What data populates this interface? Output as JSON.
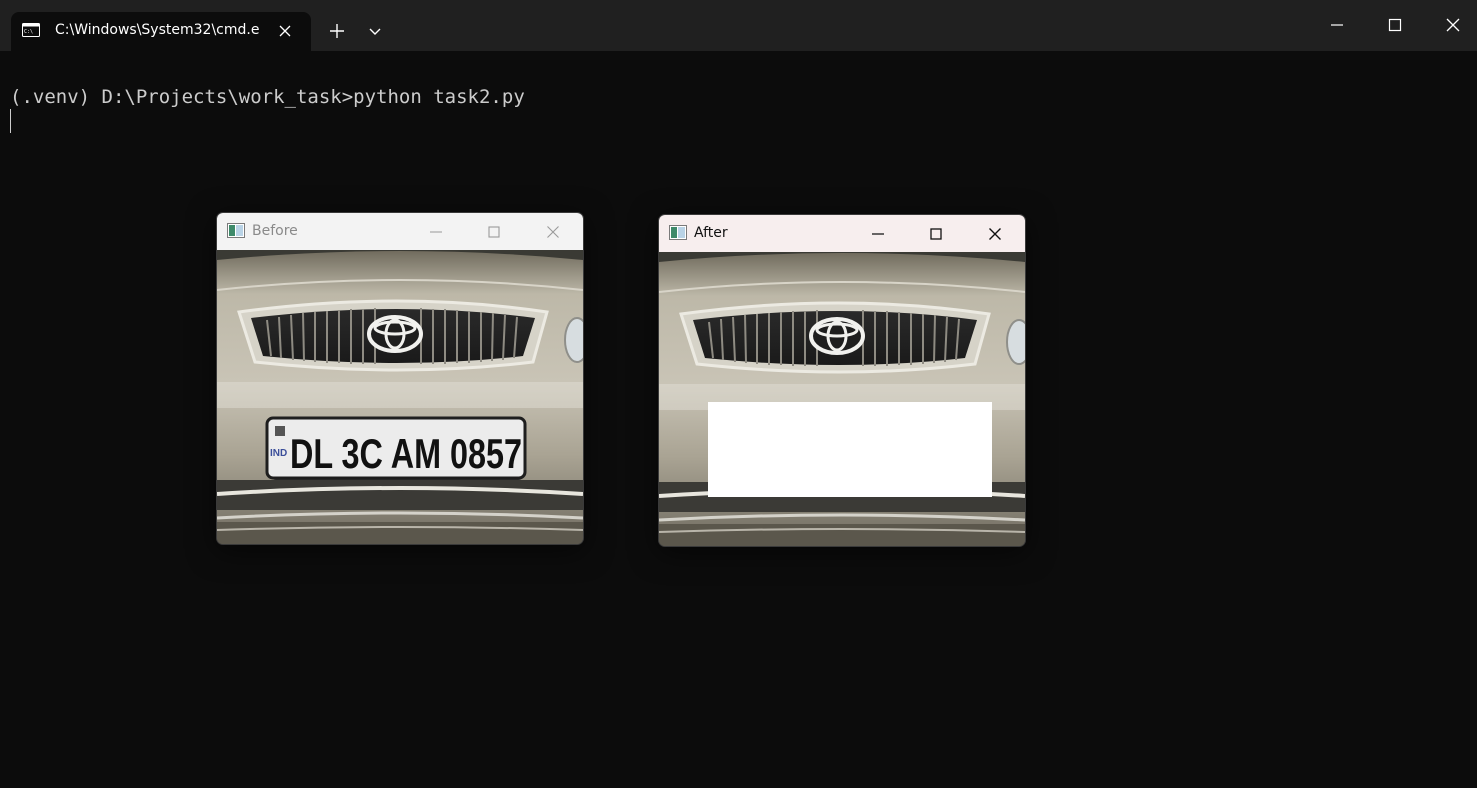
{
  "titlebar": {
    "tab_title": "C:\\Windows\\System32\\cmd.e",
    "tab_icon": "terminal-icon",
    "new_tab_icon": "plus-icon",
    "dropdown_icon": "chevron-down-icon",
    "minimize_icon": "minimize-icon",
    "maximize_icon": "maximize-icon",
    "close_icon": "close-icon"
  },
  "console": {
    "line1": "(.venv) D:\\Projects\\work_task>python task2.py"
  },
  "windows": {
    "before": {
      "title": "Before",
      "plate_text": "DL 3C AM 0857",
      "plate_prefix": "IND",
      "title_bg": "#f3f3f3",
      "title_color": "#8a8a8a",
      "active": false
    },
    "after": {
      "title": "After",
      "title_bg": "#f7eeee",
      "title_color": "#111111",
      "active": true
    }
  },
  "colors": {
    "terminal_bg": "#0c0c0c",
    "titlebar_bg": "#202020",
    "text": "#cccccc",
    "redaction": "#ffffff"
  }
}
